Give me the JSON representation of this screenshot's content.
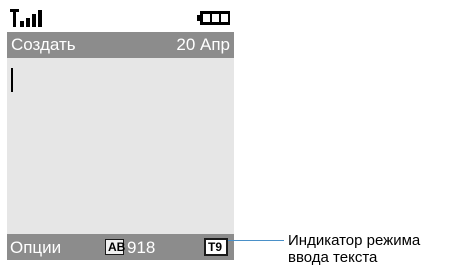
{
  "status": {
    "signal_icon": "signal-strength-icon",
    "battery_icon": "battery-icon"
  },
  "title_bar": {
    "title": "Создать",
    "date": "20 Апр"
  },
  "editor": {
    "text": ""
  },
  "soft_bar": {
    "options_label": "Опции",
    "counter_icon": "character-counter-icon",
    "counter_value": "918",
    "mode_icon": "text-input-mode-icon"
  },
  "callout": {
    "line1": "Индикатор режима",
    "line2": "ввода текста"
  },
  "colors": {
    "bar": "#8c8c8c",
    "editor_bg": "#e6e6e6",
    "callout_line": "#4a90c8"
  }
}
